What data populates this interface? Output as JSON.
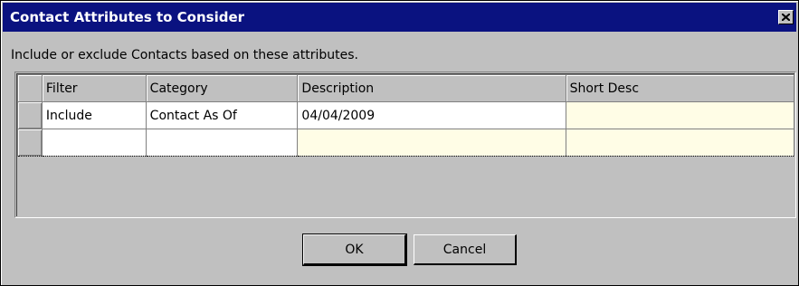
{
  "window": {
    "title": "Contact Attributes to Consider"
  },
  "instructions": "Include or exclude Contacts based on these attributes.",
  "grid": {
    "columns": [
      "Filter",
      "Category",
      "Description",
      "Short Desc"
    ],
    "rows": [
      {
        "filter": "Include",
        "category": "Contact As Of",
        "description": "04/04/2009",
        "short_desc": ""
      },
      {
        "filter": "",
        "category": "",
        "description": "",
        "short_desc": ""
      }
    ]
  },
  "buttons": {
    "ok": "OK",
    "cancel": "Cancel"
  },
  "colors": {
    "title_bar": "#0a1280",
    "dialog_bg": "#c0c0c0",
    "editable_cell": "#fffde6"
  },
  "icons": {
    "close": "close-icon"
  }
}
